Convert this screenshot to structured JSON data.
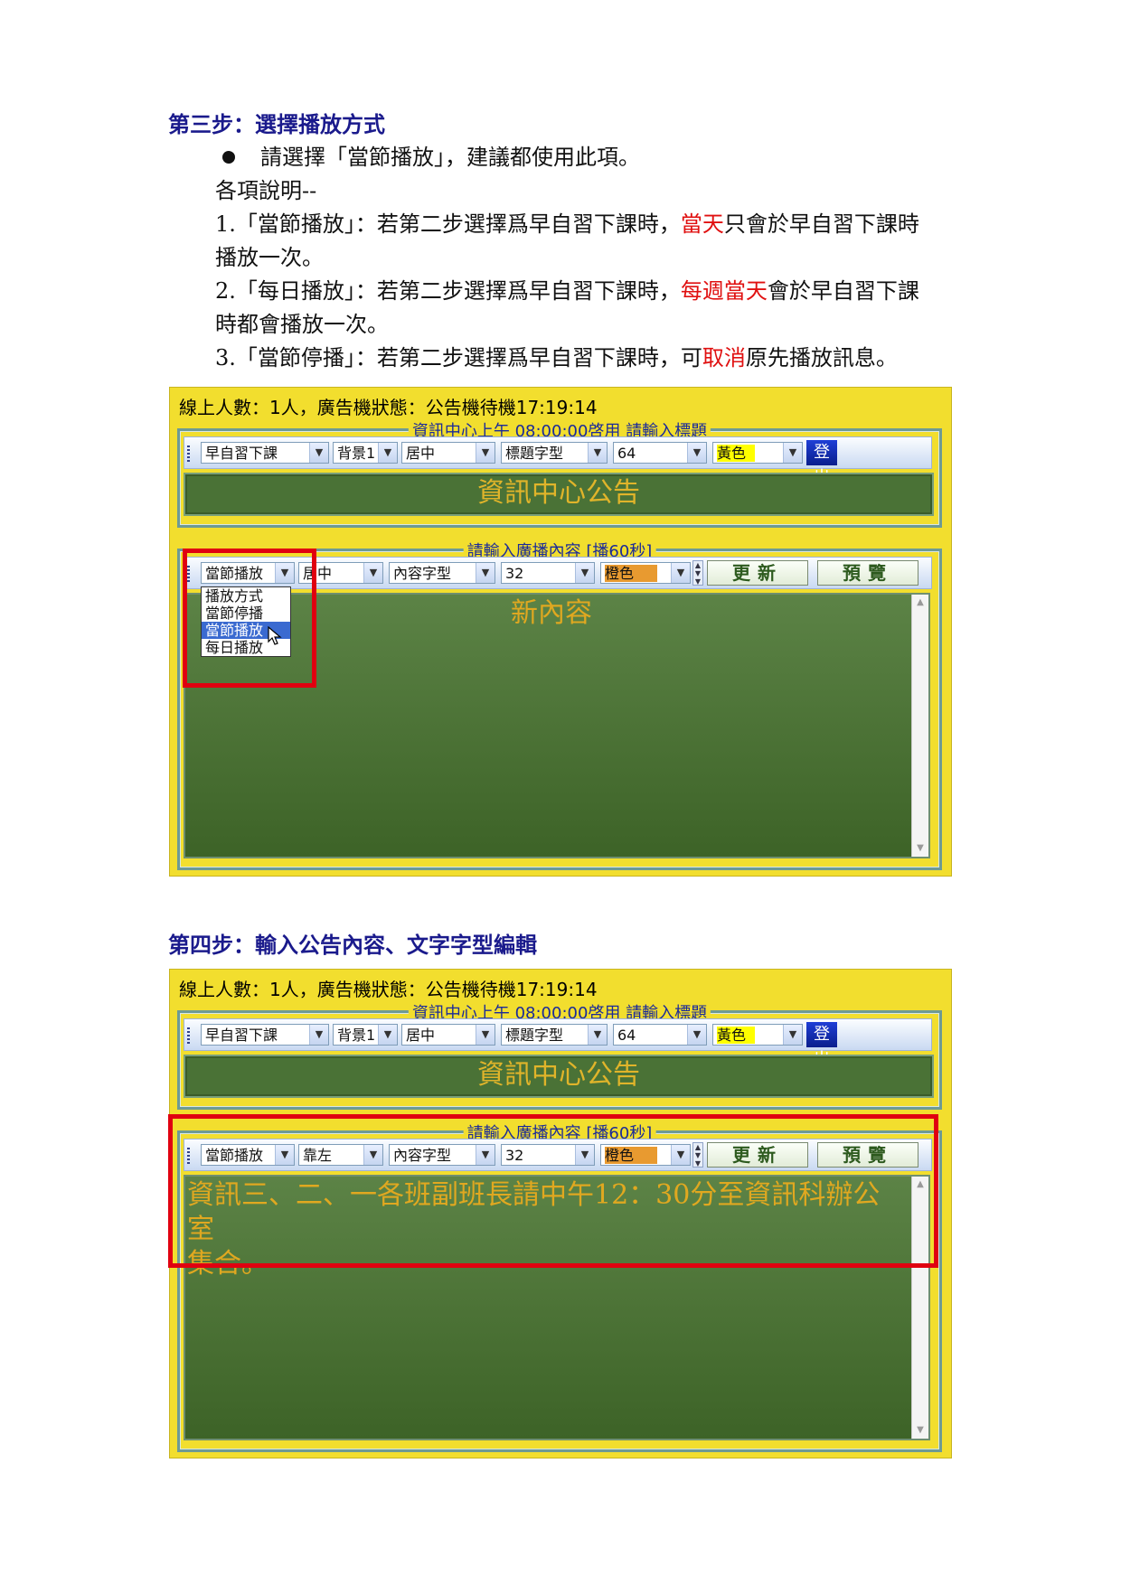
{
  "step3": {
    "title": "第三步：選擇播放方式",
    "bullet": "請選擇「當節播放」，建議都使用此項。",
    "desc_header": "各項說明--",
    "item1_a": "1.「當節播放」：若第二步選擇爲早自習下課時，",
    "item1_red": "當天",
    "item1_b": "只會於早自習下課時",
    "item1_c": "播放一次。",
    "item2_a": "2.「每日播放」：若第二步選擇爲早自習下課時，",
    "item2_red": "每週當天",
    "item2_b": "會於早自習下課",
    "item2_c": "時都會播放一次。",
    "item3_a": "3.「當節停播」：若第二步選擇爲早自習下課時，可",
    "item3_red": "取消",
    "item3_b": "原先播放訊息。"
  },
  "step4": {
    "title": "第四步：輸入公告內容、文字字型編輯"
  },
  "panel1": {
    "status": "線上人數：1人，廣告機狀態：公告機待機17:19:14",
    "title_legend": "資訊中心上午 08:00:00啓用 請輸入標題",
    "period": "早自習下課",
    "background": "背景1",
    "title_align": "居中",
    "title_font": "標題字型",
    "title_size": "64",
    "title_color": "黃色",
    "logout": "登出",
    "title_text": "資訊中心公告",
    "content_legend": "請輸入廣播內容 [播60秒]",
    "play_mode": "當節播放",
    "content_align": "居中",
    "content_font": "內容字型",
    "content_size": "32",
    "content_color": "橙色",
    "update_btn": "更新",
    "preview_btn": "預覽",
    "content_text": "新內容",
    "dropdown": [
      "播放方式",
      "當節停播",
      "當節播放",
      "每日播放"
    ]
  },
  "panel2": {
    "status": "線上人數：1人，廣告機狀態：公告機待機17:19:14",
    "title_legend": "資訊中心上午 08:00:00啓用 請輸入標題",
    "period": "早自習下課",
    "background": "背景1",
    "title_align": "居中",
    "title_font": "標題字型",
    "title_size": "64",
    "title_color": "黃色",
    "logout": "登出",
    "title_text": "資訊中心公告",
    "content_legend": "請輸入廣播內容 [播60秒]",
    "play_mode": "當節播放",
    "content_align": "靠左",
    "content_font": "內容字型",
    "content_size": "32",
    "content_color": "橙色",
    "update_btn": "更新",
    "preview_btn": "預覽",
    "content_text_line1": "資訊三、二、一各班副班長請中午12：30分至資訊科辦公室",
    "content_text_line2": "集合。"
  },
  "colors": {
    "step_title": "#1a1a8c",
    "emphasis": "#e01010",
    "panel_bg": "#f2de2e",
    "board": "#4a7236",
    "board_text": "#e0a820",
    "highlight": "#e00010"
  }
}
